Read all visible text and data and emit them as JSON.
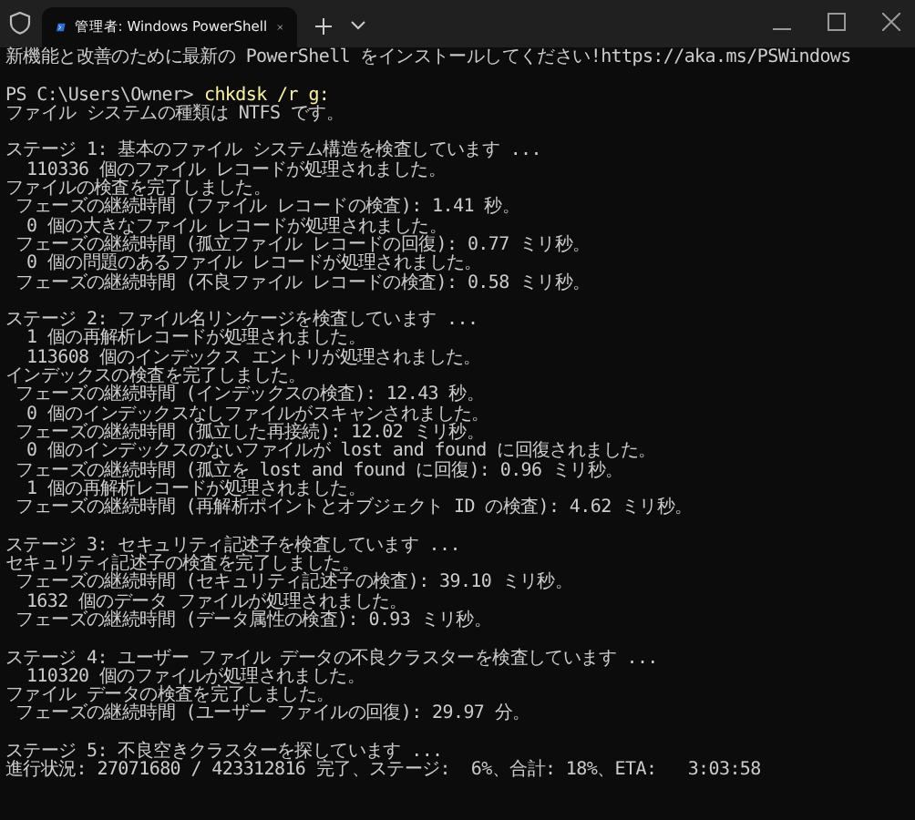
{
  "window": {
    "tab": {
      "title": "管理者: Windows PowerShell",
      "selected": true
    }
  },
  "terminal": {
    "blocks": [
      {
        "lines": [
          {
            "kind": "output",
            "text": "新機能と改善のために最新の PowerShell をインストールしてください!https://aka.ms/PSWindows"
          }
        ]
      },
      {
        "lines": [
          {
            "kind": "prompt",
            "prompt": "PS C:\\Users\\Owner>",
            "command": "chkdsk /r g:"
          },
          {
            "kind": "output",
            "text": "ファイル システムの種類は NTFS です。"
          }
        ]
      },
      {
        "lines": [
          {
            "kind": "output",
            "text": "ステージ 1: 基本のファイル システム構造を検査しています ..."
          },
          {
            "kind": "output",
            "text": "  110336 個のファイル レコードが処理されました。"
          },
          {
            "kind": "output",
            "text": "ファイルの検査を完了しました。"
          },
          {
            "kind": "output",
            "text": " フェーズの継続時間 (ファイル レコードの検査): 1.41 秒。"
          },
          {
            "kind": "output",
            "text": "  0 個の大きなファイル レコードが処理されました。"
          },
          {
            "kind": "output",
            "text": " フェーズの継続時間 (孤立ファイル レコードの回復): 0.77 ミリ秒。"
          },
          {
            "kind": "output",
            "text": "  0 個の問題のあるファイル レコードが処理されました。"
          },
          {
            "kind": "output",
            "text": " フェーズの継続時間 (不良ファイル レコードの検査): 0.58 ミリ秒。"
          }
        ]
      },
      {
        "lines": [
          {
            "kind": "output",
            "text": "ステージ 2: ファイル名リンケージを検査しています ..."
          },
          {
            "kind": "output",
            "text": "  1 個の再解析レコードが処理されました。"
          },
          {
            "kind": "output",
            "text": "  113608 個のインデックス エントリが処理されました。"
          },
          {
            "kind": "output",
            "text": "インデックスの検査を完了しました。"
          },
          {
            "kind": "output",
            "text": " フェーズの継続時間 (インデックスの検査): 12.43 秒。"
          },
          {
            "kind": "output",
            "text": "  0 個のインデックスなしファイルがスキャンされました。"
          },
          {
            "kind": "output",
            "text": " フェーズの継続時間 (孤立した再接続): 12.02 ミリ秒。"
          },
          {
            "kind": "output",
            "text": "  0 個のインデックスのないファイルが lost and found に回復されました。"
          },
          {
            "kind": "output",
            "text": " フェーズの継続時間 (孤立を lost and found に回復): 0.96 ミリ秒。"
          },
          {
            "kind": "output",
            "text": "  1 個の再解析レコードが処理されました。"
          },
          {
            "kind": "output",
            "text": " フェーズの継続時間 (再解析ポイントとオブジェクト ID の検査): 4.62 ミリ秒。"
          }
        ]
      },
      {
        "lines": [
          {
            "kind": "output",
            "text": "ステージ 3: セキュリティ記述子を検査しています ..."
          },
          {
            "kind": "output",
            "text": "セキュリティ記述子の検査を完了しました。"
          },
          {
            "kind": "output",
            "text": " フェーズの継続時間 (セキュリティ記述子の検査): 39.10 ミリ秒。"
          },
          {
            "kind": "output",
            "text": "  1632 個のデータ ファイルが処理されました。"
          },
          {
            "kind": "output",
            "text": " フェーズの継続時間 (データ属性の検査): 0.93 ミリ秒。"
          }
        ]
      },
      {
        "lines": [
          {
            "kind": "output",
            "text": "ステージ 4: ユーザー ファイル データの不良クラスターを検査しています ..."
          },
          {
            "kind": "output",
            "text": "  110320 個のファイルが処理されました。"
          },
          {
            "kind": "output",
            "text": "ファイル データの検査を完了しました。"
          },
          {
            "kind": "output",
            "text": " フェーズの継続時間 (ユーザー ファイルの回復): 29.97 分。"
          }
        ]
      },
      {
        "lines": [
          {
            "kind": "output",
            "text": "ステージ 5: 不良空きクラスターを探しています ..."
          },
          {
            "kind": "output",
            "text": "進行状況: 27071680 / 423312816 完了、ステージ:  6%、合計: 18%、ETA:   3:03:58"
          }
        ]
      }
    ]
  }
}
